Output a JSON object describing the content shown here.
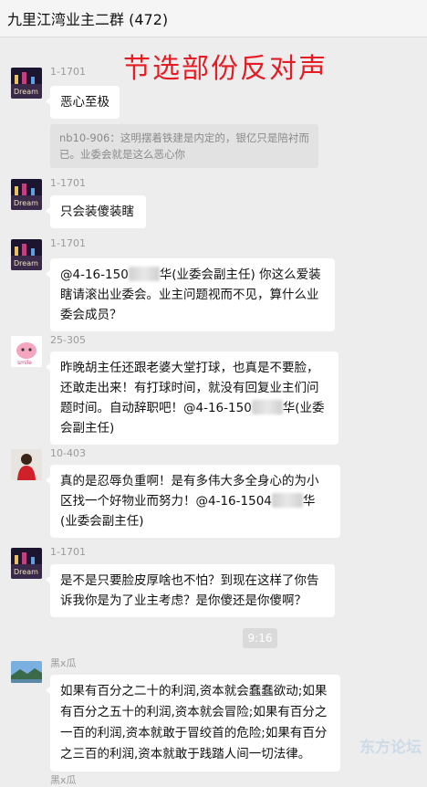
{
  "header": {
    "title": "九里江湾业主二群 (472)"
  },
  "overlay": {
    "text": "节选部份反对声"
  },
  "messages": [
    {
      "name": "1-1701",
      "text": "恶心至极",
      "quote": "nb10-906：这明摆着铁建是内定的，银亿只是陪衬而已。业委会就是这么恶心你"
    },
    {
      "name": "1-1701",
      "text": "只会装傻装瞎"
    },
    {
      "name": "1-1701",
      "part1": "@4-16-150",
      "part2": "华(业委会副主任) 你这么爱装瞎请滚出业委会。业主问题视而不见，算什么业委会成员？"
    },
    {
      "name": "25-305",
      "part1": "昨晚胡主任还跟老婆大堂打球，也真是不要脸，还敢走出来！有打球时间，就没有回复业主们问题时间。自动辞职吧！@4-16-150",
      "part2": "华(业委会副主任)"
    },
    {
      "name": "10-403",
      "part1": "真的是忍辱负重啊！是有多伟大多全身心的为小区找一个好物业而努力！@4-16-1504",
      "part2": "华(业委会副主任)"
    },
    {
      "name": "1-1701",
      "text": "是不是只要脸皮厚啥也不怕？到现在这样了你告诉我你是为了业主考虑？是你傻还是你傻啊？"
    },
    {
      "name": "黑x瓜",
      "text": "如果有百分之二十的利润,资本就会蠢蠢欲动;如果有百分之五十的利润,资本就会冒险;如果有百分之一百的利润,资本就敢于冒绞首的危险;如果有百分之三百的利润,资本就敢于践踏人间一切法律。"
    }
  ],
  "time_divider": "9:16",
  "partial_name": "黑x瓜",
  "watermark": "东方论坛"
}
